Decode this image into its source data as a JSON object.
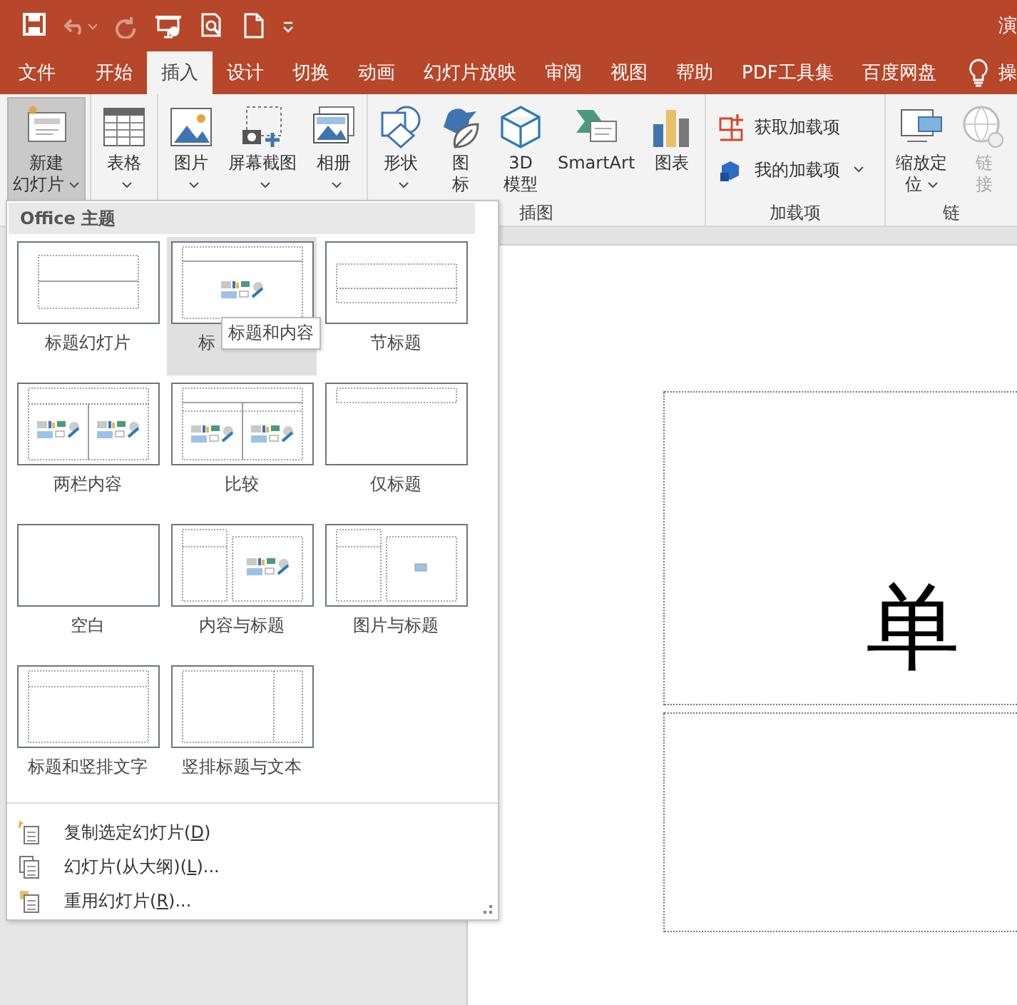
{
  "window": {
    "title": "演"
  },
  "quick_access": [
    {
      "disabled": false
    },
    {
      "disabled": true
    },
    {
      "disabled": true
    },
    {
      "disabled": false
    },
    {
      "disabled": false
    },
    {
      "disabled": false
    },
    {
      "disabled": false
    }
  ],
  "tabs": [
    {
      "label": "文件",
      "selected": false
    },
    {
      "label": "开始",
      "selected": false
    },
    {
      "label": "插入",
      "selected": true
    },
    {
      "label": "设计",
      "selected": false
    },
    {
      "label": "切换",
      "selected": false
    },
    {
      "label": "动画",
      "selected": false
    },
    {
      "label": "幻灯片放映",
      "selected": false
    },
    {
      "label": "审阅",
      "selected": false
    },
    {
      "label": "视图",
      "selected": false
    },
    {
      "label": "帮助",
      "selected": false
    },
    {
      "label": "PDF工具集",
      "selected": false
    },
    {
      "label": "百度网盘",
      "selected": false
    }
  ],
  "tell_me": {
    "label": "操"
  },
  "ribbon": {
    "groups": [
      {
        "kind": "large",
        "buttons": [
          {
            "lines": [
              "新建",
              "幻灯片"
            ],
            "caret": true,
            "pressed": true,
            "disabled": false
          }
        ]
      },
      {
        "kind": "large",
        "buttons": [
          {
            "lines": [
              "表格"
            ],
            "caret": true,
            "pressed": false,
            "disabled": false
          }
        ]
      },
      {
        "kind": "large",
        "buttons": [
          {
            "lines": [
              "图片"
            ],
            "caret": true,
            "pressed": false,
            "disabled": false
          },
          {
            "lines": [
              "屏幕截图"
            ],
            "caret": true,
            "pressed": false,
            "disabled": false
          },
          {
            "lines": [
              "相册"
            ],
            "caret": true,
            "pressed": false,
            "disabled": false
          }
        ]
      },
      {
        "kind": "large",
        "label": "插图",
        "buttons": [
          {
            "lines": [
              "形状"
            ],
            "caret": true,
            "pressed": false,
            "disabled": false
          },
          {
            "lines": [
              "图",
              "标"
            ],
            "caret": false,
            "pressed": false,
            "disabled": false
          },
          {
            "lines": [
              "3D",
              "模型"
            ],
            "caret": false,
            "pressed": false,
            "disabled": false
          },
          {
            "lines": [
              "SmartArt"
            ],
            "caret": false,
            "pressed": false,
            "disabled": false
          },
          {
            "lines": [
              "图表"
            ],
            "caret": false,
            "pressed": false,
            "disabled": false
          }
        ]
      },
      {
        "kind": "small",
        "label": "加载项",
        "buttons": [
          {
            "lines": [
              "获取加载项"
            ],
            "caret": false,
            "pressed": false,
            "disabled": false
          },
          {
            "lines": [
              "我的加载项"
            ],
            "caret": true,
            "pressed": false,
            "disabled": false
          }
        ]
      },
      {
        "kind": "large",
        "label": "链",
        "buttons": [
          {
            "lines": [
              "缩放定",
              "位"
            ],
            "caret": true,
            "pressed": false,
            "disabled": false
          },
          {
            "lines": [
              "链",
              "接"
            ],
            "caret": false,
            "pressed": false,
            "disabled": true
          }
        ]
      }
    ]
  },
  "new_slide_menu": {
    "header": "Office 主题",
    "layouts": [
      {
        "kind": "title",
        "label": "标题幻灯片",
        "selected": false
      },
      {
        "kind": "title-content",
        "label": "标",
        "selected": true
      },
      {
        "kind": "section",
        "label": "节标题",
        "selected": false
      },
      {
        "kind": "two-content",
        "label": "两栏内容",
        "selected": false
      },
      {
        "kind": "comparison",
        "label": "比较",
        "selected": false
      },
      {
        "kind": "title-only",
        "label": "仅标题",
        "selected": false
      },
      {
        "kind": "blank",
        "label": "空白",
        "selected": false
      },
      {
        "kind": "content-caption",
        "label": "内容与标题",
        "selected": false
      },
      {
        "kind": "picture-caption",
        "label": "图片与标题",
        "selected": false
      },
      {
        "kind": "title-vertical",
        "label": "标题和竖排文字",
        "selected": false
      },
      {
        "kind": "vertical-title",
        "label": "竖排标题与文本",
        "selected": false
      }
    ],
    "tooltip": "标题和内容",
    "commands": [
      {
        "before": "复制选定幻灯片(",
        "key": "D",
        "after": ")"
      },
      {
        "before": "幻灯片(从大纲)(",
        "key": "L",
        "after": ")..."
      },
      {
        "before": "重用幻灯片(",
        "key": "R",
        "after": ")..."
      }
    ]
  },
  "slide": {
    "title_placeholder": "单"
  }
}
